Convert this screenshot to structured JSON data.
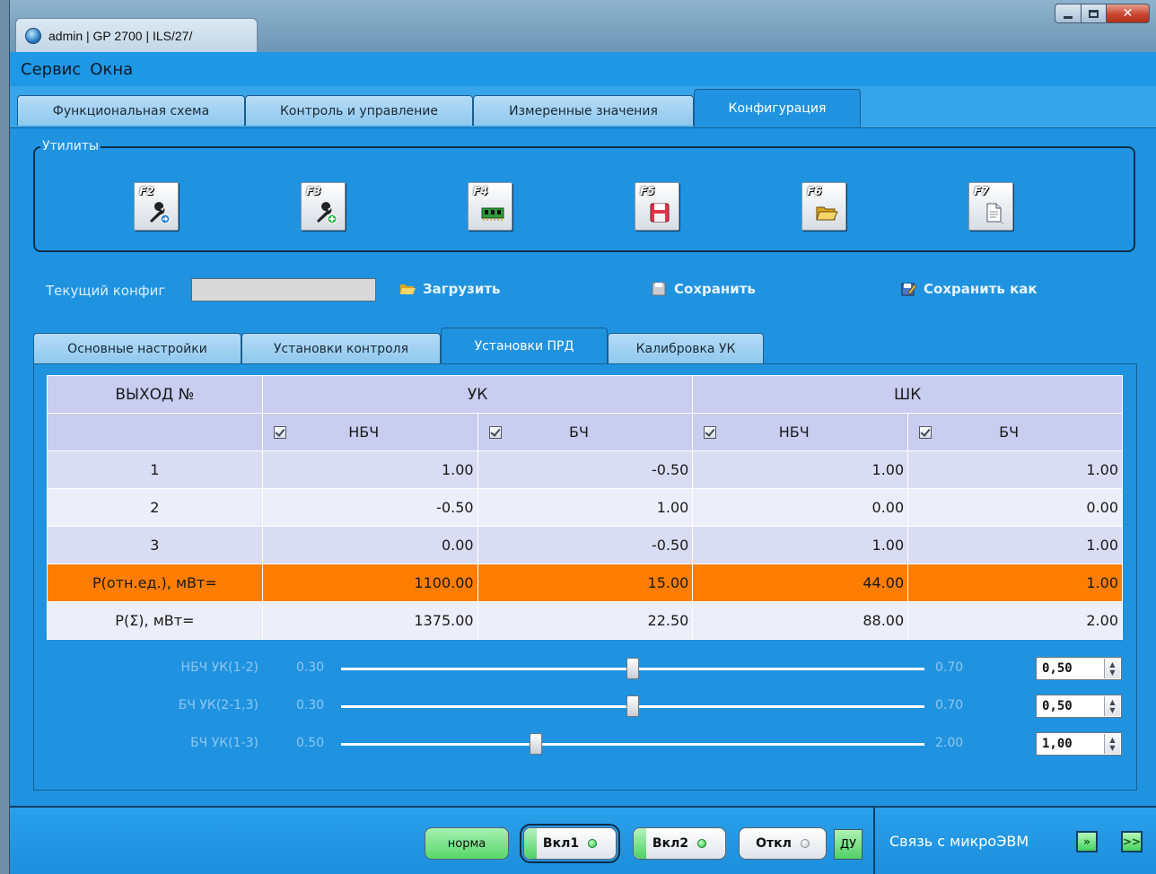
{
  "window": {
    "title": "admin | GP 2700 | ILS/27/"
  },
  "menu": [
    "Сервис",
    "Окна"
  ],
  "main_tabs": [
    {
      "label": "Функциональная схема"
    },
    {
      "label": "Контроль и управление"
    },
    {
      "label": "Измеренные значения"
    },
    {
      "label": "Конфигурация",
      "active": true
    }
  ],
  "utilities": {
    "legend": "Утилиты",
    "keys": [
      {
        "key": "F2",
        "icon": "wrench-arrow-icon"
      },
      {
        "key": "F3",
        "icon": "wrench-add-icon"
      },
      {
        "key": "F4",
        "icon": "memory-chip-icon"
      },
      {
        "key": "F5",
        "icon": "floppy-save-icon"
      },
      {
        "key": "F6",
        "icon": "folder-open-icon"
      },
      {
        "key": "F7",
        "icon": "document-menu-icon"
      }
    ]
  },
  "config": {
    "current_label": "Текущий конфиг",
    "current_value": "",
    "load": "Загрузить",
    "save": "Сохранить",
    "save_as": "Сохранить как"
  },
  "sub_tabs": [
    {
      "label": "Основные настройки"
    },
    {
      "label": "Установки контроля"
    },
    {
      "label": "Установки ПРД",
      "active": true
    },
    {
      "label": "Калибровка УК"
    }
  ],
  "table": {
    "col_output": "ВЫХОД №",
    "group_uk": "УК",
    "group_shk": "ШК",
    "sub": [
      "НБЧ",
      "БЧ",
      "НБЧ",
      "БЧ"
    ],
    "rows": [
      {
        "label": "1",
        "values": [
          "1.00",
          "-0.50",
          "1.00",
          "1.00"
        ]
      },
      {
        "label": "2",
        "values": [
          "-0.50",
          "1.00",
          "0.00",
          "0.00"
        ]
      },
      {
        "label": "3",
        "values": [
          "0.00",
          "-0.50",
          "1.00",
          "1.00"
        ]
      },
      {
        "label": "P(отн.ед.), мВт=",
        "values": [
          "1100.00",
          "15.00",
          "44.00",
          "1.00"
        ],
        "highlight": true
      },
      {
        "label": "P(Σ), мВт=",
        "values": [
          "1375.00",
          "22.50",
          "88.00",
          "2.00"
        ]
      }
    ]
  },
  "sliders": [
    {
      "label": "НБЧ УК(1-2)",
      "min": "0.30",
      "max": "0.70",
      "value": "0,50",
      "fraction": 0.5
    },
    {
      "label": "БЧ УК(2-1,3)",
      "min": "0.30",
      "max": "0.70",
      "value": "0,50",
      "fraction": 0.5
    },
    {
      "label": "БЧ УК(1-3)",
      "min": "0.50",
      "max": "2.00",
      "value": "1,00",
      "fraction": 0.3333
    }
  ],
  "status": {
    "norma": "норма",
    "vkl1": "Вкл1",
    "vkl2": "Вкл2",
    "otkl": "Откл",
    "du": "ДУ",
    "link": "Связь с микроЭВМ",
    "link_icon1": "»",
    "link_icon2": ">>"
  },
  "colors": {
    "accent_bg": "#1f93e0",
    "highlight_row": "#ff7d00",
    "table_header": "#c9cdf0"
  }
}
